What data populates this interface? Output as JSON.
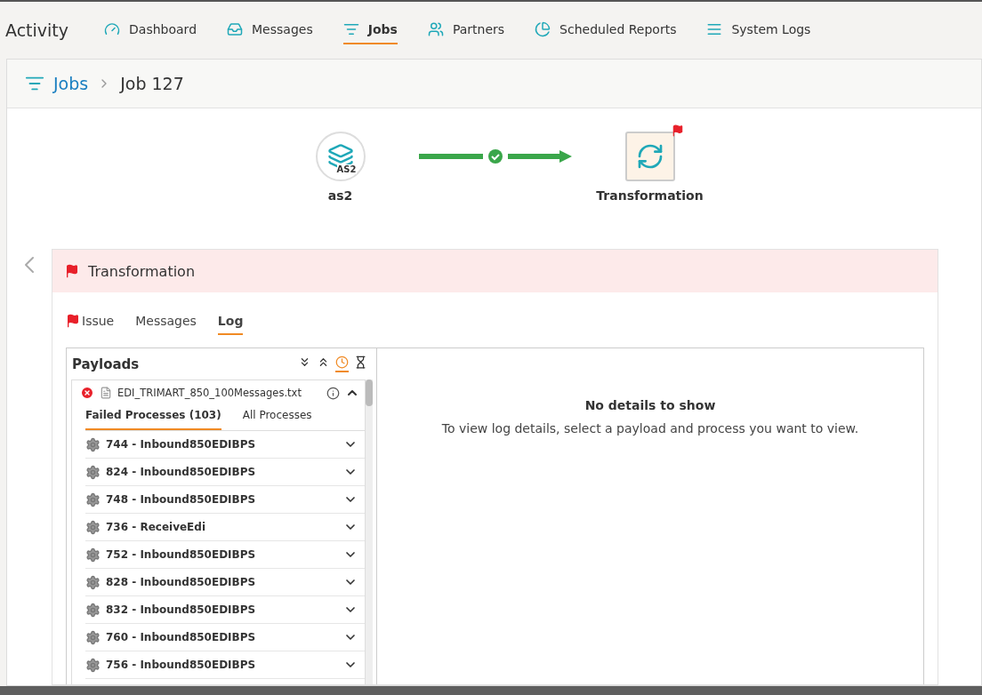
{
  "app_title": "Activity",
  "nav": [
    {
      "label": "Dashboard",
      "selected": false
    },
    {
      "label": "Messages",
      "selected": false
    },
    {
      "label": "Jobs",
      "selected": true
    },
    {
      "label": "Partners",
      "selected": false
    },
    {
      "label": "Scheduled Reports",
      "selected": false
    },
    {
      "label": "System Logs",
      "selected": false
    }
  ],
  "breadcrumb": {
    "parent": "Jobs",
    "current": "Job 127"
  },
  "flow": {
    "nodes": [
      {
        "label": "as2",
        "kind": "circle",
        "badge": "AS2",
        "flagged": false
      },
      {
        "label": "Transformation",
        "kind": "square",
        "flagged": true
      }
    ]
  },
  "panel": {
    "title": "Transformation",
    "flagged": true,
    "tabs": [
      {
        "label": "Issue",
        "flagged": true,
        "selected": false
      },
      {
        "label": "Messages",
        "flagged": false,
        "selected": false
      },
      {
        "label": "Log",
        "flagged": false,
        "selected": true
      }
    ],
    "payloads": {
      "title": "Payloads",
      "tools": [
        {
          "selected": false
        },
        {
          "selected": false
        },
        {
          "selected": true
        },
        {
          "selected": false
        }
      ],
      "file": {
        "name": "EDI_TRIMART_850_100Messages.txt",
        "failed": true,
        "expanded": true
      },
      "tabs": [
        {
          "label": "Failed Processes (103)",
          "selected": true
        },
        {
          "label": "All Processes",
          "selected": false
        }
      ],
      "processes": [
        {
          "label": "744 - Inbound850EDIBPS",
          "expanded": false
        },
        {
          "label": "824 - Inbound850EDIBPS",
          "expanded": false
        },
        {
          "label": "748 - Inbound850EDIBPS",
          "expanded": false
        },
        {
          "label": "736 - ReceiveEdi",
          "expanded": false
        },
        {
          "label": "752 - Inbound850EDIBPS",
          "expanded": false
        },
        {
          "label": "828 - Inbound850EDIBPS",
          "expanded": false
        },
        {
          "label": "832 - Inbound850EDIBPS",
          "expanded": false
        },
        {
          "label": "760 - Inbound850EDIBPS",
          "expanded": false
        },
        {
          "label": "756 - Inbound850EDIBPS",
          "expanded": false
        }
      ]
    },
    "details": {
      "title": "No details to show",
      "message": "To view log details, select a payload and process you want to view."
    }
  }
}
